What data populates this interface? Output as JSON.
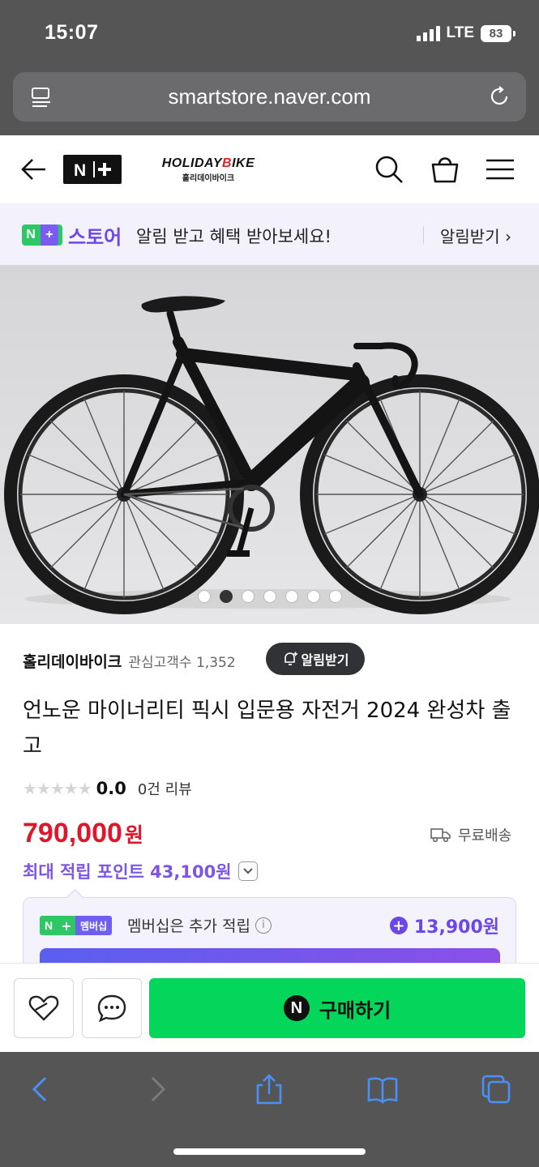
{
  "status_bar": {
    "time": "15:07",
    "network": "LTE",
    "battery": "83"
  },
  "browser": {
    "url": "smartstore.naver.com"
  },
  "header": {
    "logo_brand": "HOLIDAYBIKE",
    "logo_brand_pre": "HOLIDAY",
    "logo_brand_accent": "B",
    "logo_brand_post": "IKE",
    "logo_sub": "홀리데이바이크"
  },
  "banner": {
    "store_word": "스토어",
    "message": "알림 받고 혜택 받아보세요!",
    "action": "알림받기 ›"
  },
  "carousel": {
    "total": 7,
    "active_index": 1
  },
  "store": {
    "name": "홀리데이바이크",
    "followers": "관심고객수 1,352",
    "alarm_button": "알림받기"
  },
  "product": {
    "title": "언노운 마이너리티 픽시 입문용 자전거 2024 완성차 출고",
    "rating_score": "0.0",
    "rating_value": 0,
    "review_count": "0건 리뷰",
    "price": "790,000",
    "price_unit": "원",
    "shipping": "무료배송",
    "points": "최대 적립 포인트 43,100원"
  },
  "membership": {
    "badge_label": "멤버십",
    "text": "멤버십은 추가 적립",
    "amount": "13,900원"
  },
  "purchase_bar": {
    "buy_label": "구매하기"
  },
  "colors": {
    "price_red": "#e0162b",
    "points_purple": "#7d55e6",
    "buy_green": "#03d65a",
    "naver_green": "#2ec766",
    "browser_chrome": "#555556",
    "safari_blue": "#4a8ff5"
  }
}
